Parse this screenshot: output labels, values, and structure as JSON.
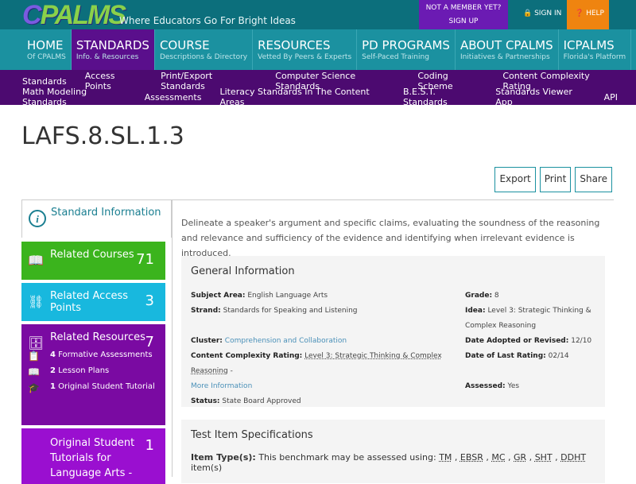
{
  "header": {
    "logo": "CPALMS",
    "tagline": "Where Educators Go For Bright Ideas",
    "signup_line1": "NOT A MEMBER YET?",
    "signup_line2": "SIGN UP",
    "signin": "SIGN IN",
    "help": "HELP"
  },
  "nav": [
    {
      "title": "HOME",
      "sub": "Of CPALMS"
    },
    {
      "title": "STANDARDS",
      "sub": "Info. & Resources"
    },
    {
      "title": "COURSE",
      "sub": "Descriptions & Directory"
    },
    {
      "title": "RESOURCES",
      "sub": "Vetted By Peers & Experts"
    },
    {
      "title": "PD PROGRAMS",
      "sub": "Self-Paced Training"
    },
    {
      "title": "ABOUT CPALMS",
      "sub": "Initiatives & Partnerships"
    },
    {
      "title": "ICPALMS",
      "sub": "Florida's Platform"
    }
  ],
  "subnav": {
    "row1": [
      "Standards",
      "Access Points",
      "Print/Export Standards",
      "Computer Science Standards",
      "Coding Scheme",
      "Content Complexity Rating"
    ],
    "row2": [
      "Math Modeling Standards",
      "Assessments",
      "Literacy Standards In The Content Areas",
      "B.E.S.T. Standards",
      "Standards Viewer App",
      "API"
    ]
  },
  "page_title": "LAFS.8.SL.1.3",
  "actions": {
    "export": "Export",
    "print": "Print",
    "share": "Share"
  },
  "sidebar": {
    "standard_info": "Standard Information",
    "courses": {
      "label": "Related Courses",
      "count": "71"
    },
    "access": {
      "label": "Related Access Points",
      "count": "3"
    },
    "resources": {
      "label": "Related Resources",
      "count": "7",
      "items": [
        {
          "n": "4",
          "label": "Formative Assessments"
        },
        {
          "n": "2",
          "label": "Lesson Plans"
        },
        {
          "n": "1",
          "label": "Original Student Tutorial"
        }
      ]
    },
    "tutorials": {
      "label": "Original Student Tutorials for Language Arts -",
      "count": "1"
    }
  },
  "description": "Delineate a speaker's argument and specific claims, evaluating the soundness of the reasoning and relevance and sufficiency of the evidence and identifying when irrelevant evidence is introduced.",
  "general": {
    "title": "General Information",
    "subject_k": "Subject Area:",
    "subject_v": "English Language Arts",
    "strand_k": "Strand:",
    "strand_v": "Standards for Speaking and Listening",
    "cluster_k": "Cluster:",
    "cluster_v": "Comprehension and Collaboration",
    "ccr_k": "Content Complexity Rating:",
    "ccr_v": "Level 3: Strategic Thinking & Complex Reasoning",
    "ccr_more": "More Information",
    "status_k": "Status:",
    "status_v": "State Board Approved",
    "grade_k": "Grade:",
    "grade_v": "8",
    "idea_k": "Idea:",
    "idea_v": "Level 3: Strategic Thinking & Complex Reasoning",
    "adopted_k": "Date Adopted or Revised:",
    "adopted_v": "12/10",
    "rating_k": "Date of Last Rating:",
    "rating_v": "02/14",
    "assessed_k": "Assessed:",
    "assessed_v": "Yes"
  },
  "specs": {
    "title": "Test Item Specifications",
    "item_k": "Item Type(s):",
    "item_v": "This benchmark may be assessed using:",
    "types": [
      "TM",
      "EBSR",
      "MC",
      "GR",
      "SHT",
      "DDHT"
    ],
    "suffix": "item(s)"
  }
}
